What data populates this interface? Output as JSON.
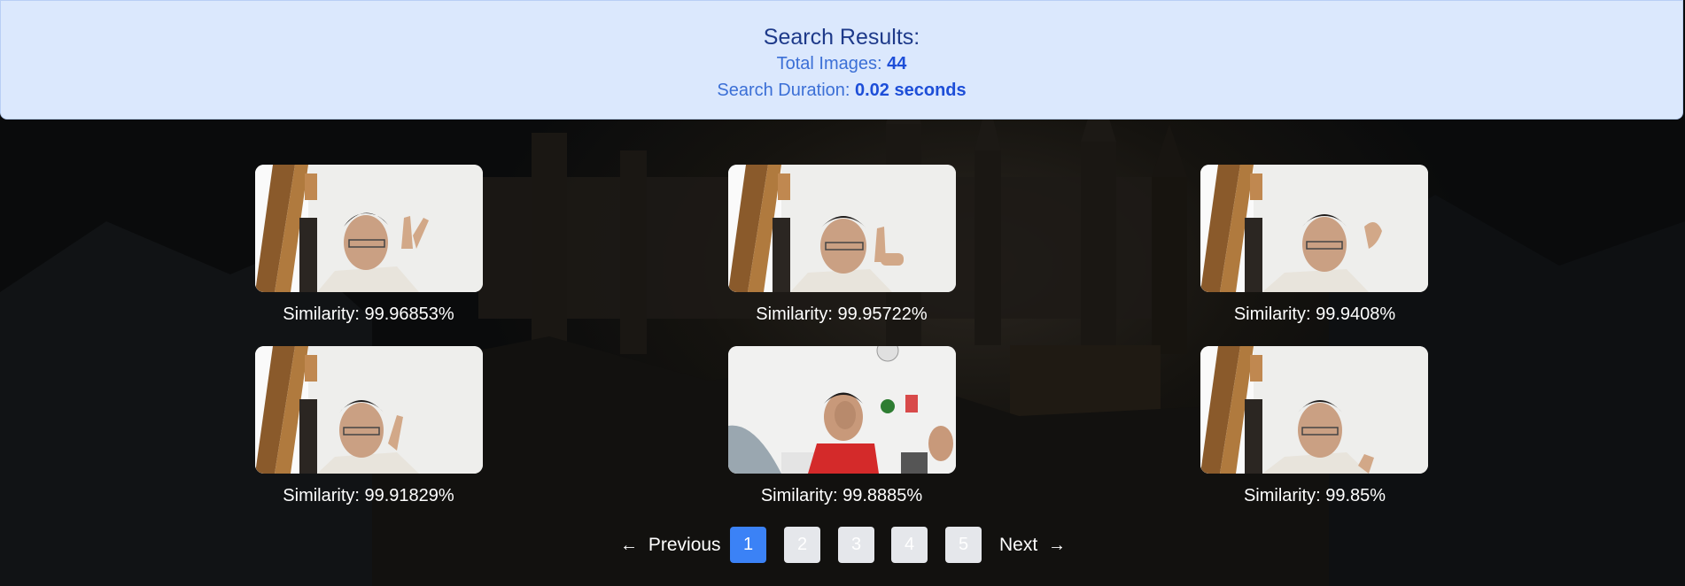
{
  "header": {
    "title": "Search Results:",
    "total_label": "Total Images:",
    "total_value": "44",
    "duration_label": "Search Duration:",
    "duration_value": "0.02 seconds"
  },
  "results": [
    {
      "similarity": "Similarity: 99.96853%"
    },
    {
      "similarity": "Similarity: 99.95722%"
    },
    {
      "similarity": "Similarity: 99.9408%"
    },
    {
      "similarity": "Similarity: 99.91829%"
    },
    {
      "similarity": "Similarity: 99.8885%"
    },
    {
      "similarity": "Similarity: 99.85%"
    }
  ],
  "pagination": {
    "previous_label": "Previous",
    "next_label": "Next",
    "pages": [
      "1",
      "2",
      "3",
      "4",
      "5"
    ],
    "current_page": "1"
  },
  "colors": {
    "header_bg": "#dbe8fd",
    "title": "#1e3a8a",
    "accent": "#3b82f6",
    "inactive_page": "#e5e7eb"
  }
}
